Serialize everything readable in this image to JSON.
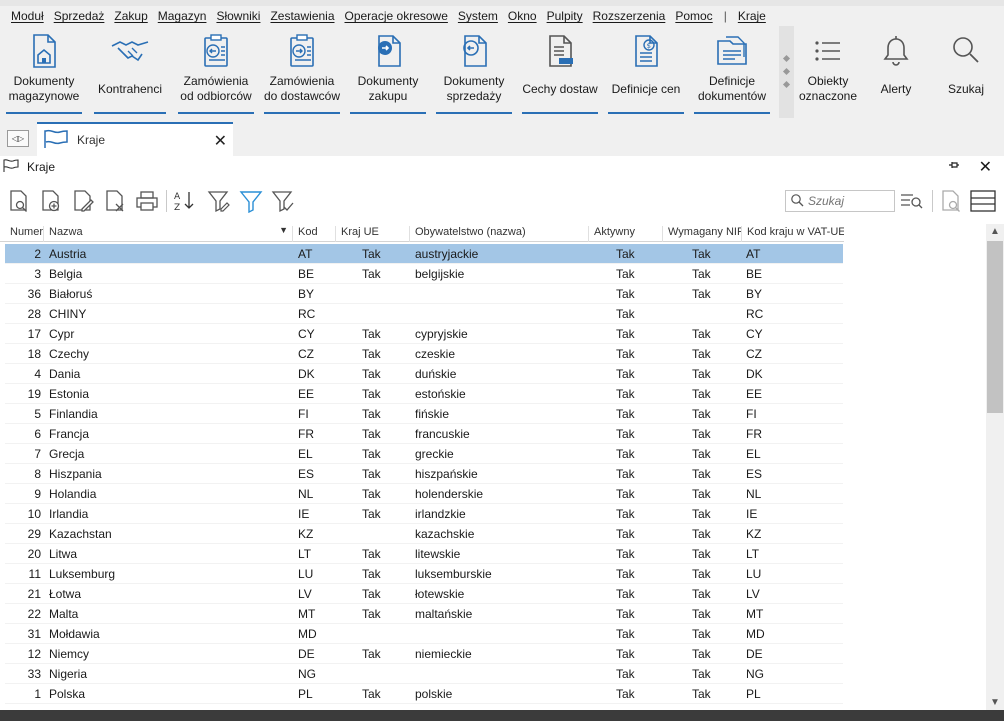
{
  "menu": [
    "Moduł",
    "Sprzedaż",
    "Zakup",
    "Magazyn",
    "Słowniki",
    "Zestawienia",
    "Operacje okresowe",
    "System",
    "Okno",
    "Pulpity",
    "Rozszerzenia",
    "Pomoc",
    "|",
    "Kraje"
  ],
  "ribbon": {
    "dok_mag": "Dokumenty magazynowe",
    "kontrahenci": "Kontrahenci",
    "zam_odb": "Zamówienia od odbiorców",
    "zam_dost": "Zamówienia do dostawców",
    "dok_zak": "Dokumenty zakupu",
    "dok_sprz": "Dokumenty sprzedaży",
    "cechy": "Cechy dostaw",
    "def_cen": "Definicje cen",
    "def_dok": "Definicje dokumentów",
    "obiekty": "Obiekty oznaczone",
    "alerty": "Alerty",
    "szukaj": "Szukaj"
  },
  "tab": {
    "label": "Kraje"
  },
  "window": {
    "title": "Kraje"
  },
  "search": {
    "placeholder": "Szukaj"
  },
  "columns": [
    "Numer",
    "Nazwa",
    "Kod",
    "Kraj UE",
    "Obywatelstwo (nazwa)",
    "Aktywny",
    "Wymagany NIP",
    "Kod kraju w VAT-UE"
  ],
  "rows": [
    [
      "2",
      "Austria",
      "AT",
      "Tak",
      "austryjackie",
      "Tak",
      "Tak",
      "AT"
    ],
    [
      "3",
      "Belgia",
      "BE",
      "Tak",
      "belgijskie",
      "Tak",
      "Tak",
      "BE"
    ],
    [
      "36",
      "Białoruś",
      "BY",
      "",
      "",
      "Tak",
      "Tak",
      "BY"
    ],
    [
      "28",
      "CHINY",
      "RC",
      "",
      "",
      "Tak",
      "",
      "RC"
    ],
    [
      "17",
      "Cypr",
      "CY",
      "Tak",
      "cypryjskie",
      "Tak",
      "Tak",
      "CY"
    ],
    [
      "18",
      "Czechy",
      "CZ",
      "Tak",
      "czeskie",
      "Tak",
      "Tak",
      "CZ"
    ],
    [
      "4",
      "Dania",
      "DK",
      "Tak",
      "duńskie",
      "Tak",
      "Tak",
      "DK"
    ],
    [
      "19",
      "Estonia",
      "EE",
      "Tak",
      "estońskie",
      "Tak",
      "Tak",
      "EE"
    ],
    [
      "5",
      "Finlandia",
      "FI",
      "Tak",
      "fińskie",
      "Tak",
      "Tak",
      "FI"
    ],
    [
      "6",
      "Francja",
      "FR",
      "Tak",
      "francuskie",
      "Tak",
      "Tak",
      "FR"
    ],
    [
      "7",
      "Grecja",
      "EL",
      "Tak",
      "greckie",
      "Tak",
      "Tak",
      "EL"
    ],
    [
      "8",
      "Hiszpania",
      "ES",
      "Tak",
      "hiszpańskie",
      "Tak",
      "Tak",
      "ES"
    ],
    [
      "9",
      "Holandia",
      "NL",
      "Tak",
      "holenderskie",
      "Tak",
      "Tak",
      "NL"
    ],
    [
      "10",
      "Irlandia",
      "IE",
      "Tak",
      "irlandzkie",
      "Tak",
      "Tak",
      "IE"
    ],
    [
      "29",
      "Kazachstan",
      "KZ",
      "",
      "kazachskie",
      "Tak",
      "Tak",
      "KZ"
    ],
    [
      "20",
      "Litwa",
      "LT",
      "Tak",
      "litewskie",
      "Tak",
      "Tak",
      "LT"
    ],
    [
      "11",
      "Luksemburg",
      "LU",
      "Tak",
      "luksemburskie",
      "Tak",
      "Tak",
      "LU"
    ],
    [
      "21",
      "Łotwa",
      "LV",
      "Tak",
      "łotewskie",
      "Tak",
      "Tak",
      "LV"
    ],
    [
      "22",
      "Malta",
      "MT",
      "Tak",
      "maltańskie",
      "Tak",
      "Tak",
      "MT"
    ],
    [
      "31",
      "Mołdawia",
      "MD",
      "",
      "",
      "Tak",
      "Tak",
      "MD"
    ],
    [
      "12",
      "Niemcy",
      "DE",
      "Tak",
      "niemieckie",
      "Tak",
      "Tak",
      "DE"
    ],
    [
      "33",
      "Nigeria",
      "NG",
      "",
      "",
      "Tak",
      "Tak",
      "NG"
    ],
    [
      "1",
      "Polska",
      "PL",
      "Tak",
      "polskie",
      "Tak",
      "Tak",
      "PL"
    ]
  ],
  "colors": {
    "accent": "#2a6fb5",
    "selection": "#a3c6e6",
    "chrome": "#f0f0f0"
  }
}
